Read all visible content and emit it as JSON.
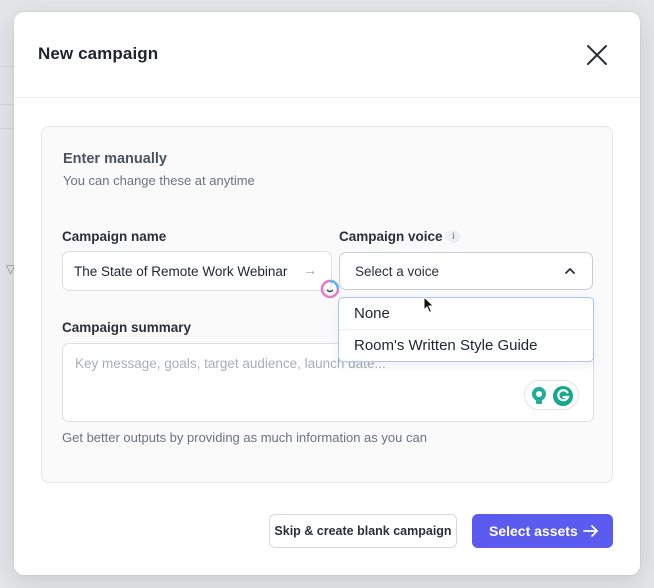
{
  "modal": {
    "title": "New campaign"
  },
  "section": {
    "title": "Enter manually",
    "subtitle": "You can change these at anytime"
  },
  "campaign_name": {
    "label": "Campaign name",
    "value": "The State of Remote Work Webinar",
    "arrow_glyph": "→"
  },
  "campaign_voice": {
    "label": "Campaign voice",
    "info_glyph": "i",
    "selected": "Select a voice",
    "options": [
      "None",
      "Room's Written Style Guide"
    ]
  },
  "campaign_summary": {
    "label": "Campaign summary",
    "placeholder": "Key message, goals, target audience, launch date...",
    "hint": "Get better outputs by providing as much information as you can"
  },
  "buttons": {
    "skip": "Skip & create blank campaign",
    "primary": "Select assets"
  },
  "colors": {
    "primary": "#5b5bf0",
    "dropdown_border": "#a9c4f5",
    "grammarly": "#15a88a"
  },
  "icons": {
    "close": "close-icon",
    "info": "info-icon",
    "chevron": "chevron-up-icon",
    "spinner": "ai-spinner-icon",
    "lightbulb": "lightbulb-icon",
    "grammarly": "grammarly-icon",
    "arrow": "arrow-right-icon",
    "cursor": "mouse-cursor-icon"
  }
}
